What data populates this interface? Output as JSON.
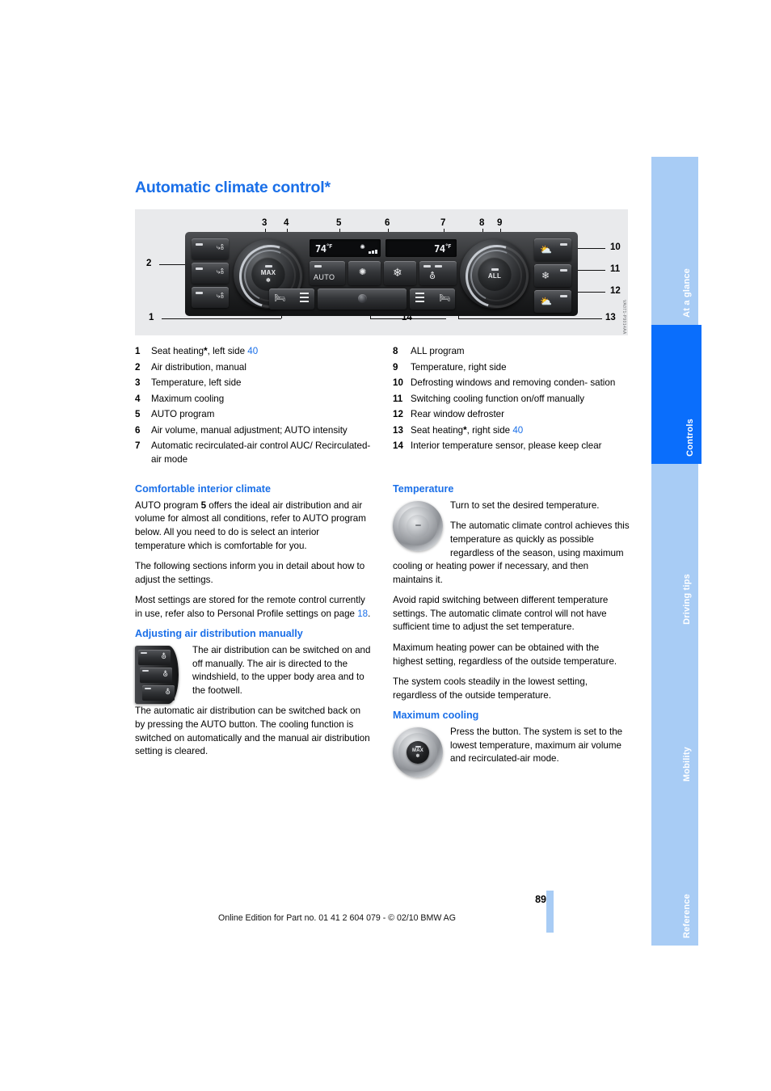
{
  "page_title": "Automatic climate control*",
  "figure": {
    "credit": "VA071-P9014AA",
    "lcd": {
      "left_temp": "74",
      "left_unit": "°F",
      "right_temp": "74",
      "right_unit": "°F",
      "fan_icon": "fan-icon"
    },
    "left_knob_label": "MAX",
    "right_knob_label": "ALL",
    "auto_label": "AUTO",
    "callouts": [
      "1",
      "2",
      "3",
      "4",
      "5",
      "6",
      "7",
      "8",
      "9",
      "10",
      "11",
      "12",
      "13",
      "14"
    ]
  },
  "legend": {
    "left": [
      {
        "num": "1",
        "text": "Seat heating",
        "asterisk": "*",
        "rest": ", left side",
        "pageref": "40"
      },
      {
        "num": "2",
        "text": "Air distribution, manual"
      },
      {
        "num": "3",
        "text": "Temperature, left side"
      },
      {
        "num": "4",
        "text": "Maximum cooling"
      },
      {
        "num": "5",
        "text": "AUTO program"
      },
      {
        "num": "6",
        "text": "Air volume, manual adjustment; AUTO intensity"
      },
      {
        "num": "7",
        "text": "Automatic recirculated-air control AUC/ Recirculated-air mode"
      }
    ],
    "right": [
      {
        "num": "8",
        "text": "ALL program"
      },
      {
        "num": "9",
        "text": "Temperature, right side"
      },
      {
        "num": "10",
        "text": "Defrosting windows and removing conden- sation"
      },
      {
        "num": "11",
        "text": "Switching cooling function on/off manually"
      },
      {
        "num": "12",
        "text": "Rear window defroster"
      },
      {
        "num": "13",
        "text": "Seat heating",
        "asterisk": "*",
        "rest": ", right side",
        "pageref": "40"
      },
      {
        "num": "14",
        "text": "Interior temperature sensor, please keep clear"
      }
    ]
  },
  "left_column": {
    "section1_heading": "Comfortable interior climate",
    "section1_p1_a": "AUTO program ",
    "section1_p1_b": "5",
    "section1_p1_c": " offers the ideal air distribution and air volume for almost all conditions, refer to AUTO program below. All you need to do is select an interior temperature which is comfortable for you.",
    "section1_p2": "The following sections inform you in detail about how to adjust the settings.",
    "section1_p3_a": "Most settings are stored for the remote control currently in use, refer also to Personal Profile settings on page ",
    "section1_p3_pageref": "18",
    "section1_p3_b": ".",
    "section2_heading": "Adjusting air distribution manually",
    "section2_p1": "The air distribution can be switched on and off manually. The air is directed to the windshield, to the upper body area and to the footwell.",
    "section2_p2": "The automatic air distribution can be switched back on by pressing the AUTO button. The cooling function is switched on automatically and the manual air distribution setting is cleared."
  },
  "right_column": {
    "section1_heading": "Temperature",
    "section1_p1": "Turn to set the desired temperature.",
    "section1_p2": "The automatic climate control achieves this temperature as quickly as possible regardless of the season, using maximum cooling or heating power if necessary, and then maintains it.",
    "section1_p3": "Avoid rapid switching between different temperature settings. The automatic climate control will not have sufficient time to adjust the set temperature.",
    "section1_p4": "Maximum heating power can be obtained with the highest setting, regardless of the outside temperature.",
    "section1_p5": "The system cools steadily in the lowest setting, regardless of the outside temperature.",
    "section2_heading": "Maximum cooling",
    "section2_p1": "Press the button. The system is set to the lowest temperature, maximum air volume and recirculated-air mode.",
    "knob_label": "MAX"
  },
  "footer": {
    "page_number": "89",
    "text": "Online Edition for Part no. 01 41 2 604 079 - © 02/10 BMW AG"
  },
  "tabs": [
    {
      "label": "At a glance",
      "active": false
    },
    {
      "label": "Controls",
      "active": true
    },
    {
      "label": "Driving tips",
      "active": false
    },
    {
      "label": "Mobility",
      "active": false
    },
    {
      "label": "Reference",
      "active": false
    }
  ],
  "colors": {
    "heading_blue": "#1a6fe8",
    "tab_active": "#0a6efc",
    "tab_inactive": "#a8ccf5",
    "figure_bg": "#e9eaec"
  }
}
